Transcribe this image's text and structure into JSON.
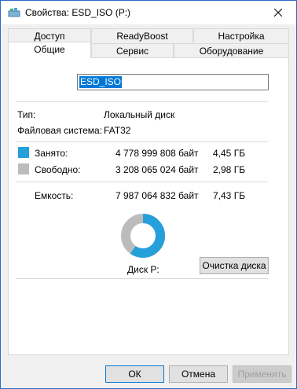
{
  "window": {
    "title": "Свойства: ESD_ISO (P:)"
  },
  "tabs": {
    "row1": [
      "Доступ",
      "ReadyBoost",
      "Настройка"
    ],
    "row2": [
      "Общие",
      "Сервис",
      "Оборудование"
    ],
    "active": "Общие"
  },
  "general": {
    "volume_name": "ESD_ISO",
    "type_label": "Тип:",
    "type_value": "Локальный диск",
    "fs_label": "Файловая система:",
    "fs_value": "FAT32",
    "used_label": "Занято:",
    "used_bytes": "4 778 999 808 байт",
    "used_size": "4,45 ГБ",
    "free_label": "Свободно:",
    "free_bytes": "3 208 065 024 байт",
    "free_size": "2,98 ГБ",
    "capacity_label": "Емкость:",
    "capacity_bytes": "7 987 064 832 байт",
    "capacity_size": "7,43 ГБ",
    "disk_label": "Диск P:",
    "cleanup_button": "Очистка диска",
    "used_fraction": 0.598
  },
  "colors": {
    "used": "#26a0da",
    "free": "#bcbcbc",
    "accent": "#0078d7"
  },
  "buttons": {
    "ok": "ОК",
    "cancel": "Отмена",
    "apply": "Применить"
  }
}
